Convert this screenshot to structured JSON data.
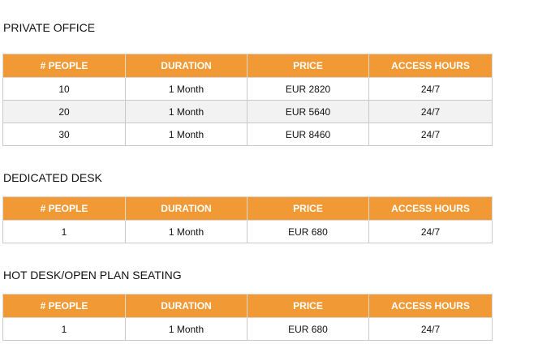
{
  "headers": [
    "# PEOPLE",
    "DURATION",
    "PRICE",
    "ACCESS HOURS"
  ],
  "colors": {
    "header_bg": "#f19a35",
    "header_text": "#ffffff",
    "border": "#c9c9c9",
    "alt_row": "#f2f2f2"
  },
  "sections": [
    {
      "title": "PRIVATE OFFICE",
      "rows": [
        [
          "10",
          "1 Month",
          "EUR 2820",
          "24/7"
        ],
        [
          "20",
          "1 Month",
          "EUR 5640",
          "24/7"
        ],
        [
          "30",
          "1 Month",
          "EUR 8460",
          "24/7"
        ]
      ]
    },
    {
      "title": "DEDICATED DESK",
      "rows": [
        [
          "1",
          "1 Month",
          "EUR 680",
          "24/7"
        ]
      ]
    },
    {
      "title": "HOT DESK/OPEN PLAN SEATING",
      "rows": [
        [
          "1",
          "1 Month",
          "EUR 680",
          "24/7"
        ]
      ]
    }
  ]
}
